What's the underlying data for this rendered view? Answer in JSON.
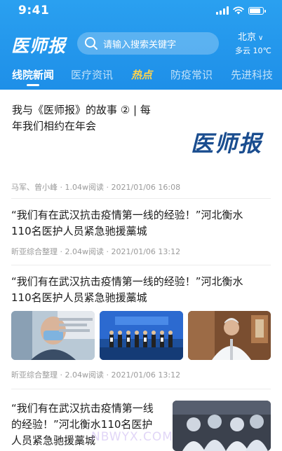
{
  "status_bar": {
    "time": "9:41"
  },
  "header": {
    "logo": "医师报",
    "search_placeholder": "请输入搜索关键字",
    "city": "北京",
    "weather": "多云 10℃"
  },
  "tabs": [
    {
      "label": "线院新闻"
    },
    {
      "label": "医疗资讯"
    },
    {
      "label": "热点"
    },
    {
      "label": "防疫常识"
    },
    {
      "label": "先进科技"
    }
  ],
  "feed": [
    {
      "title_line1": "我与《医师报》的故事 ② | 每",
      "title_line2": "年我们相约在年会",
      "image_text": "医师报",
      "authors": "马军、曾小峰",
      "reads": "1.04w阅读",
      "date": "2021/01/06 16:08"
    },
    {
      "title_line1": "“我们有在武汉抗击疫情第一线的经验！”河北衡水",
      "title_line2": "110名医护人员紧急驰援藁城",
      "authors": "昕亚综合整理",
      "reads": "2.04w阅读",
      "date": "2021/01/06 13:12"
    },
    {
      "title_line1": "“我们有在武汉抗击疫情第一线的经验！”河北衡水",
      "title_line2": "110名医护人员紧急驰援藁城",
      "authors": "昕亚综合整理",
      "reads": "2.04w阅读",
      "date": "2021/01/06 13:12"
    },
    {
      "title_line1": "“我们有在武汉抗击疫情第一线",
      "title_line2": "的经验！”河北衡水110名医护",
      "title_line3": "人员紧急驰援藁城"
    }
  ],
  "watermark": "NBWYX.COM"
}
